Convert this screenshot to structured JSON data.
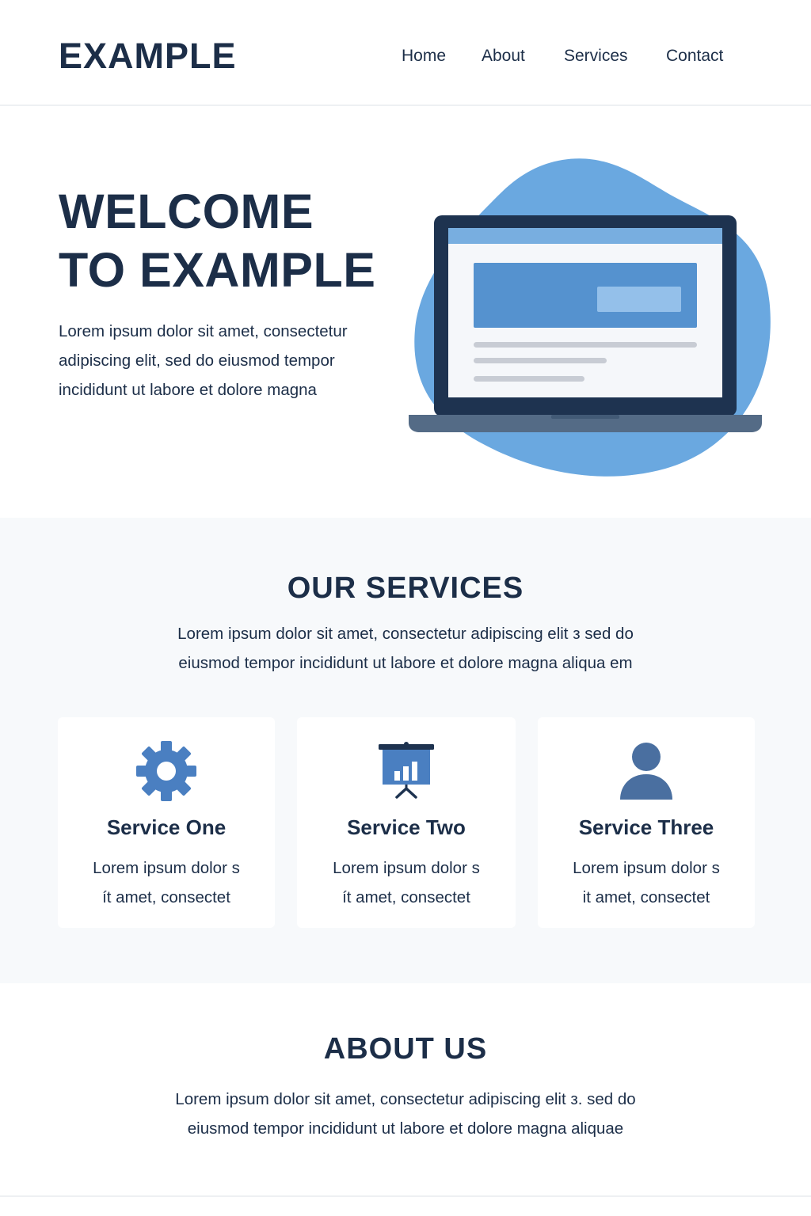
{
  "header": {
    "logo": "EXAMPLE",
    "nav": [
      {
        "label": "Home"
      },
      {
        "label": "About"
      },
      {
        "label": "Services"
      },
      {
        "label": "Contact"
      }
    ]
  },
  "hero": {
    "title_line1": "WELCOME",
    "title_line2": "TO EXAMPLE",
    "text": "Lorem ipsum dolor sit amet, consectetur adipiscing elit, sed do eiusmod tempor incididunt ut labore et dolore magna",
    "illustration": "laptop-illustration"
  },
  "services": {
    "title": "OUR SERVICES",
    "text_line1": "Lorem ipsum dolor sit amet, consectetur adipiscing elit з sed do",
    "text_line2": "eiusmod tempor incididunt ut labore et dolore magna aliqua em",
    "cards": [
      {
        "icon": "gear-icon",
        "title": "Service One",
        "text_line1": "Lorem ipsum dolor s",
        "text_line2": "ít amet, consectet"
      },
      {
        "icon": "presentation-chart-icon",
        "title": "Service Two",
        "text_line1": "Lorem ipsum dolor s",
        "text_line2": "ít amet, consectet"
      },
      {
        "icon": "user-icon",
        "title": "Service Three",
        "text_line1": "Lorem ipsum dolor s",
        "text_line2": "it amet, consectet"
      }
    ]
  },
  "about": {
    "title": "ABOUT US",
    "text_line1": "Lorem ipsum dolor sit amet, consectetur adipiscing elit з. sed do",
    "text_line2": "eiusmod tempor incididunt ut labore et dolore magna aliquae"
  },
  "colors": {
    "primary_text": "#1c2e48",
    "accent_blue": "#4a7fc1",
    "blob_blue": "#6aa8e0",
    "section_bg": "#f7f9fb"
  }
}
